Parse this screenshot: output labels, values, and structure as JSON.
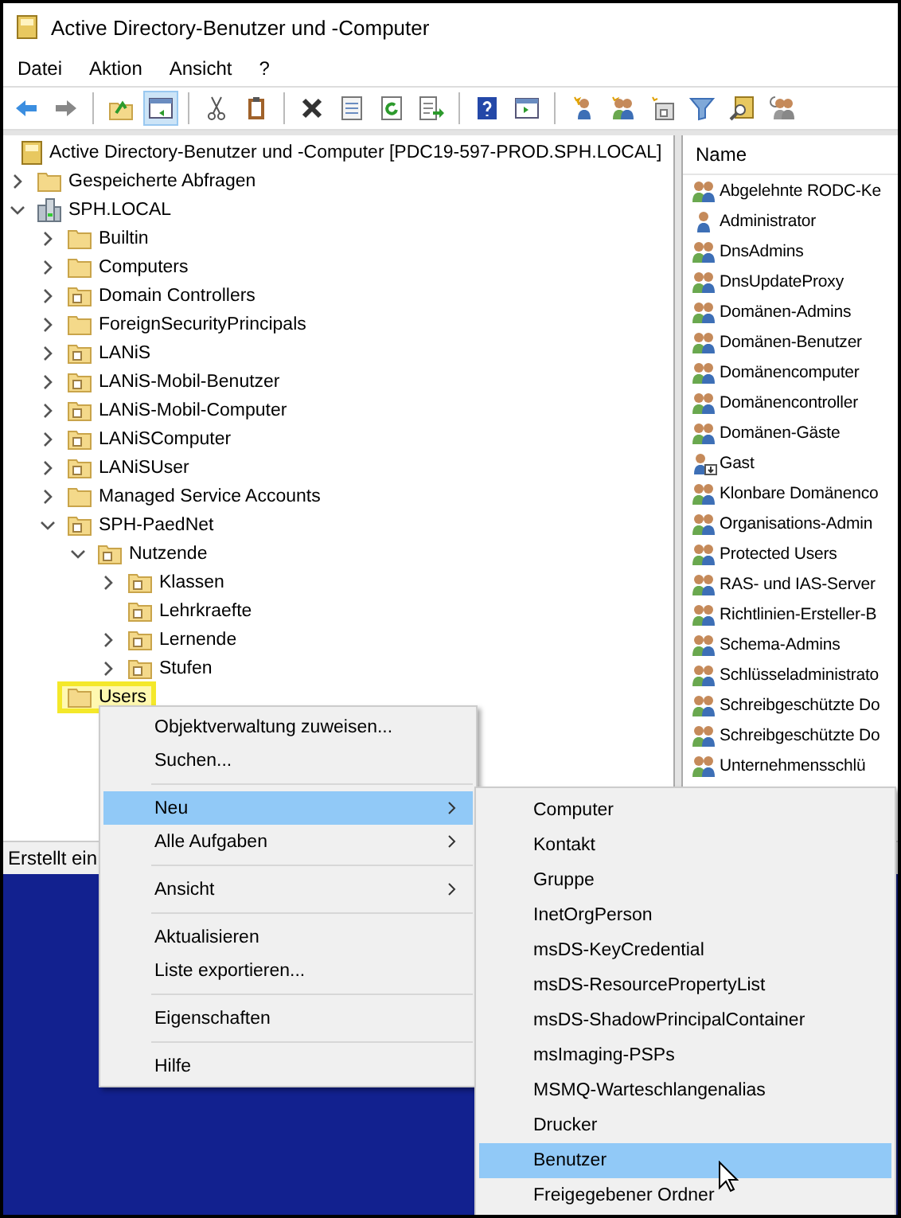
{
  "window": {
    "title": "Active Directory-Benutzer und -Computer"
  },
  "menu_bar": [
    "Datei",
    "Aktion",
    "Ansicht",
    "?"
  ],
  "toolbar": [
    {
      "kind": "back",
      "pressed": false
    },
    {
      "kind": "forward",
      "pressed": false
    },
    {
      "kind": "separator"
    },
    {
      "kind": "up",
      "pressed": false
    },
    {
      "kind": "console-tree",
      "pressed": true
    },
    {
      "kind": "separator"
    },
    {
      "kind": "cut",
      "pressed": false
    },
    {
      "kind": "paste",
      "pressed": false
    },
    {
      "kind": "separator"
    },
    {
      "kind": "delete",
      "pressed": false
    },
    {
      "kind": "properties",
      "pressed": false
    },
    {
      "kind": "refresh",
      "pressed": false
    },
    {
      "kind": "export",
      "pressed": false
    },
    {
      "kind": "separator"
    },
    {
      "kind": "help",
      "pressed": false
    },
    {
      "kind": "action-pane",
      "pressed": false
    },
    {
      "kind": "separator"
    },
    {
      "kind": "new-user",
      "pressed": false
    },
    {
      "kind": "new-group",
      "pressed": false
    },
    {
      "kind": "new-ou",
      "pressed": false
    },
    {
      "kind": "filter",
      "pressed": false
    },
    {
      "kind": "find",
      "pressed": false
    },
    {
      "kind": "add-to-group",
      "pressed": false
    }
  ],
  "tree": {
    "label": "Active Directory-Benutzer und -Computer [PDC19-597-PROD.SPH.LOCAL]",
    "children": [
      {
        "label": "Gespeicherte Abfragen",
        "kind": "folder",
        "expanded": false,
        "highlighted": false
      },
      {
        "label": "SPH.LOCAL",
        "kind": "domain",
        "expanded": true,
        "highlighted": false,
        "children": [
          {
            "label": "Builtin",
            "kind": "folder",
            "expanded": false,
            "highlighted": false
          },
          {
            "label": "Computers",
            "kind": "folder",
            "expanded": false,
            "highlighted": false
          },
          {
            "label": "Domain Controllers",
            "kind": "ou",
            "expanded": false,
            "highlighted": false
          },
          {
            "label": "ForeignSecurityPrincipals",
            "kind": "folder",
            "expanded": false,
            "highlighted": false
          },
          {
            "label": "LANiS",
            "kind": "ou",
            "expanded": false,
            "highlighted": false
          },
          {
            "label": "LANiS-Mobil-Benutzer",
            "kind": "ou",
            "expanded": false,
            "highlighted": false
          },
          {
            "label": "LANiS-Mobil-Computer",
            "kind": "ou",
            "expanded": false,
            "highlighted": false
          },
          {
            "label": "LANiSComputer",
            "kind": "ou",
            "expanded": false,
            "highlighted": false
          },
          {
            "label": "LANiSUser",
            "kind": "ou",
            "expanded": false,
            "highlighted": false
          },
          {
            "label": "Managed Service Accounts",
            "kind": "folder",
            "expanded": false,
            "highlighted": false
          },
          {
            "label": "SPH-PaedNet",
            "kind": "ou",
            "expanded": true,
            "highlighted": false,
            "children": [
              {
                "label": "Nutzende",
                "kind": "ou",
                "expanded": true,
                "highlighted": false,
                "children": [
                  {
                    "label": "Klassen",
                    "kind": "ou",
                    "expanded": false,
                    "highlighted": false
                  },
                  {
                    "label": "Lehrkraefte",
                    "kind": "ou",
                    "highlighted": false
                  },
                  {
                    "label": "Lernende",
                    "kind": "ou",
                    "expanded": false,
                    "highlighted": false
                  },
                  {
                    "label": "Stufen",
                    "kind": "ou",
                    "expanded": false,
                    "highlighted": false
                  }
                ]
              }
            ]
          },
          {
            "label": "Users",
            "kind": "folder",
            "highlighted": true
          }
        ]
      }
    ]
  },
  "list": {
    "columns": [
      "Name"
    ],
    "rows": [
      {
        "name": "Abgelehnte RODC-Ke",
        "kind": "group"
      },
      {
        "name": "Administrator",
        "kind": "user"
      },
      {
        "name": "DnsAdmins",
        "kind": "group"
      },
      {
        "name": "DnsUpdateProxy",
        "kind": "group"
      },
      {
        "name": "Domänen-Admins",
        "kind": "group"
      },
      {
        "name": "Domänen-Benutzer",
        "kind": "group"
      },
      {
        "name": "Domänencomputer",
        "kind": "group"
      },
      {
        "name": "Domänencontroller",
        "kind": "group"
      },
      {
        "name": "Domänen-Gäste",
        "kind": "group"
      },
      {
        "name": "Gast",
        "kind": "disabled-user"
      },
      {
        "name": "Klonbare Domänenco",
        "kind": "group"
      },
      {
        "name": "Organisations-Admin",
        "kind": "group"
      },
      {
        "name": "Protected Users",
        "kind": "group"
      },
      {
        "name": "RAS- und IAS-Server",
        "kind": "group"
      },
      {
        "name": "Richtlinien-Ersteller-B",
        "kind": "group"
      },
      {
        "name": "Schema-Admins",
        "kind": "group"
      },
      {
        "name": "Schlüsseladministrato",
        "kind": "group"
      },
      {
        "name": "Schreibgeschützte Do",
        "kind": "group"
      },
      {
        "name": "Schreibgeschützte Do",
        "kind": "group"
      },
      {
        "name": "Unternehmensschlü",
        "kind": "group"
      }
    ]
  },
  "status_bar": "Erstellt ein",
  "context_menu": {
    "groups": [
      [
        {
          "label": "Objektverwaltung zuweisen...",
          "submenu": false,
          "selected": false
        },
        {
          "label": "Suchen...",
          "submenu": false,
          "selected": false
        }
      ],
      [
        {
          "label": "Neu",
          "submenu": true,
          "selected": true
        },
        {
          "label": "Alle Aufgaben",
          "submenu": true,
          "selected": false
        }
      ],
      [
        {
          "label": "Ansicht",
          "submenu": true,
          "selected": false
        }
      ],
      [
        {
          "label": "Aktualisieren",
          "submenu": false,
          "selected": false
        },
        {
          "label": "Liste exportieren...",
          "submenu": false,
          "selected": false
        }
      ],
      [
        {
          "label": "Eigenschaften",
          "submenu": false,
          "selected": false
        }
      ],
      [
        {
          "label": "Hilfe",
          "submenu": false,
          "selected": false
        }
      ]
    ]
  },
  "submenu": {
    "items": [
      {
        "label": "Computer",
        "selected": false
      },
      {
        "label": "Kontakt",
        "selected": false
      },
      {
        "label": "Gruppe",
        "selected": false
      },
      {
        "label": "InetOrgPerson",
        "selected": false
      },
      {
        "label": "msDS-KeyCredential",
        "selected": false
      },
      {
        "label": "msDS-ResourcePropertyList",
        "selected": false
      },
      {
        "label": "msDS-ShadowPrincipalContainer",
        "selected": false
      },
      {
        "label": "msImaging-PSPs",
        "selected": false
      },
      {
        "label": "MSMQ-Warteschlangenalias",
        "selected": false
      },
      {
        "label": "Drucker",
        "selected": false
      },
      {
        "label": "Benutzer",
        "selected": true
      },
      {
        "label": "Freigegebener Ordner",
        "selected": false
      }
    ]
  }
}
